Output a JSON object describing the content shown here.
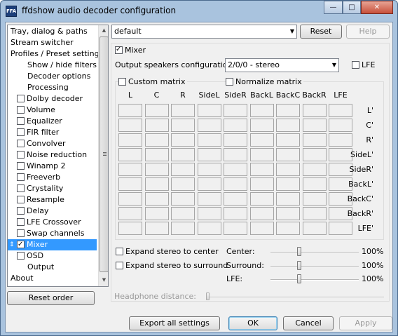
{
  "window": {
    "title": "ffdshow audio decoder configuration",
    "icon_text": "FFA"
  },
  "titlebar_buttons": {
    "minimize": "—",
    "maximize": "□",
    "close": "✕"
  },
  "tree": {
    "items": [
      {
        "label": "Tray, dialog & paths",
        "level": 0,
        "checkbox": false
      },
      {
        "label": "Stream switcher",
        "level": 0,
        "checkbox": false
      },
      {
        "label": "Profiles / Preset settings",
        "level": 0,
        "checkbox": false
      },
      {
        "label": "Show / hide filters",
        "level": 1,
        "checkbox": false
      },
      {
        "label": "Decoder options",
        "level": 1,
        "checkbox": false
      },
      {
        "label": "Processing",
        "level": 1,
        "checkbox": false
      },
      {
        "label": "Dolby decoder",
        "level": 1,
        "checkbox": true,
        "checked": false
      },
      {
        "label": "Volume",
        "level": 1,
        "checkbox": true,
        "checked": false
      },
      {
        "label": "Equalizer",
        "level": 1,
        "checkbox": true,
        "checked": false
      },
      {
        "label": "FIR filter",
        "level": 1,
        "checkbox": true,
        "checked": false
      },
      {
        "label": "Convolver",
        "level": 1,
        "checkbox": true,
        "checked": false
      },
      {
        "label": "Noise reduction",
        "level": 1,
        "checkbox": true,
        "checked": false
      },
      {
        "label": "Winamp 2",
        "level": 1,
        "checkbox": true,
        "checked": false
      },
      {
        "label": "Freeverb",
        "level": 1,
        "checkbox": true,
        "checked": false
      },
      {
        "label": "Crystality",
        "level": 1,
        "checkbox": true,
        "checked": false
      },
      {
        "label": "Resample",
        "level": 1,
        "checkbox": true,
        "checked": false
      },
      {
        "label": "Delay",
        "level": 1,
        "checkbox": true,
        "checked": false
      },
      {
        "label": "LFE Crossover",
        "level": 1,
        "checkbox": true,
        "checked": false
      },
      {
        "label": "Swap channels",
        "level": 1,
        "checkbox": true,
        "checked": false
      },
      {
        "label": "Mixer",
        "level": 1,
        "checkbox": true,
        "checked": true,
        "selected": true
      },
      {
        "label": "OSD",
        "level": 1,
        "checkbox": true,
        "checked": false
      },
      {
        "label": "Output",
        "level": 1,
        "checkbox": false
      },
      {
        "label": "About",
        "level": 0,
        "checkbox": false
      }
    ]
  },
  "reset_order_label": "Reset order",
  "preset": {
    "value": "default",
    "reset_label": "Reset",
    "help_label": "Help"
  },
  "mixer": {
    "enable_label": "Mixer",
    "enabled": true,
    "output_config_label": "Output speakers configuration:",
    "output_config_value": "2/0/0 - stereo",
    "lfe_label": "LFE",
    "custom_matrix_label": "Custom matrix",
    "normalize_matrix_label": "Normalize matrix",
    "columns": [
      "L",
      "C",
      "R",
      "SideL",
      "SideR",
      "BackL",
      "BackC",
      "BackR",
      "LFE"
    ],
    "rows": [
      "L'",
      "C'",
      "R'",
      "SideL'",
      "SideR'",
      "BackL'",
      "BackC'",
      "BackR'",
      "LFE'"
    ],
    "expand_center_label": "Expand stereo to center",
    "expand_surround_label": "Expand stereo to surround",
    "center_label": "Center:",
    "center_value": "100%",
    "center_level": 0.0,
    "surround_label": "Surround:",
    "surround_value": "100%",
    "surround_level": 0.0,
    "lfe_level_label": "LFE:",
    "lfe_value": "100%",
    "lfe_level": 0.0,
    "headphone_label": "Headphone distance:"
  },
  "footer": {
    "export_label": "Export all settings",
    "ok_label": "OK",
    "cancel_label": "Cancel",
    "apply_label": "Apply"
  }
}
